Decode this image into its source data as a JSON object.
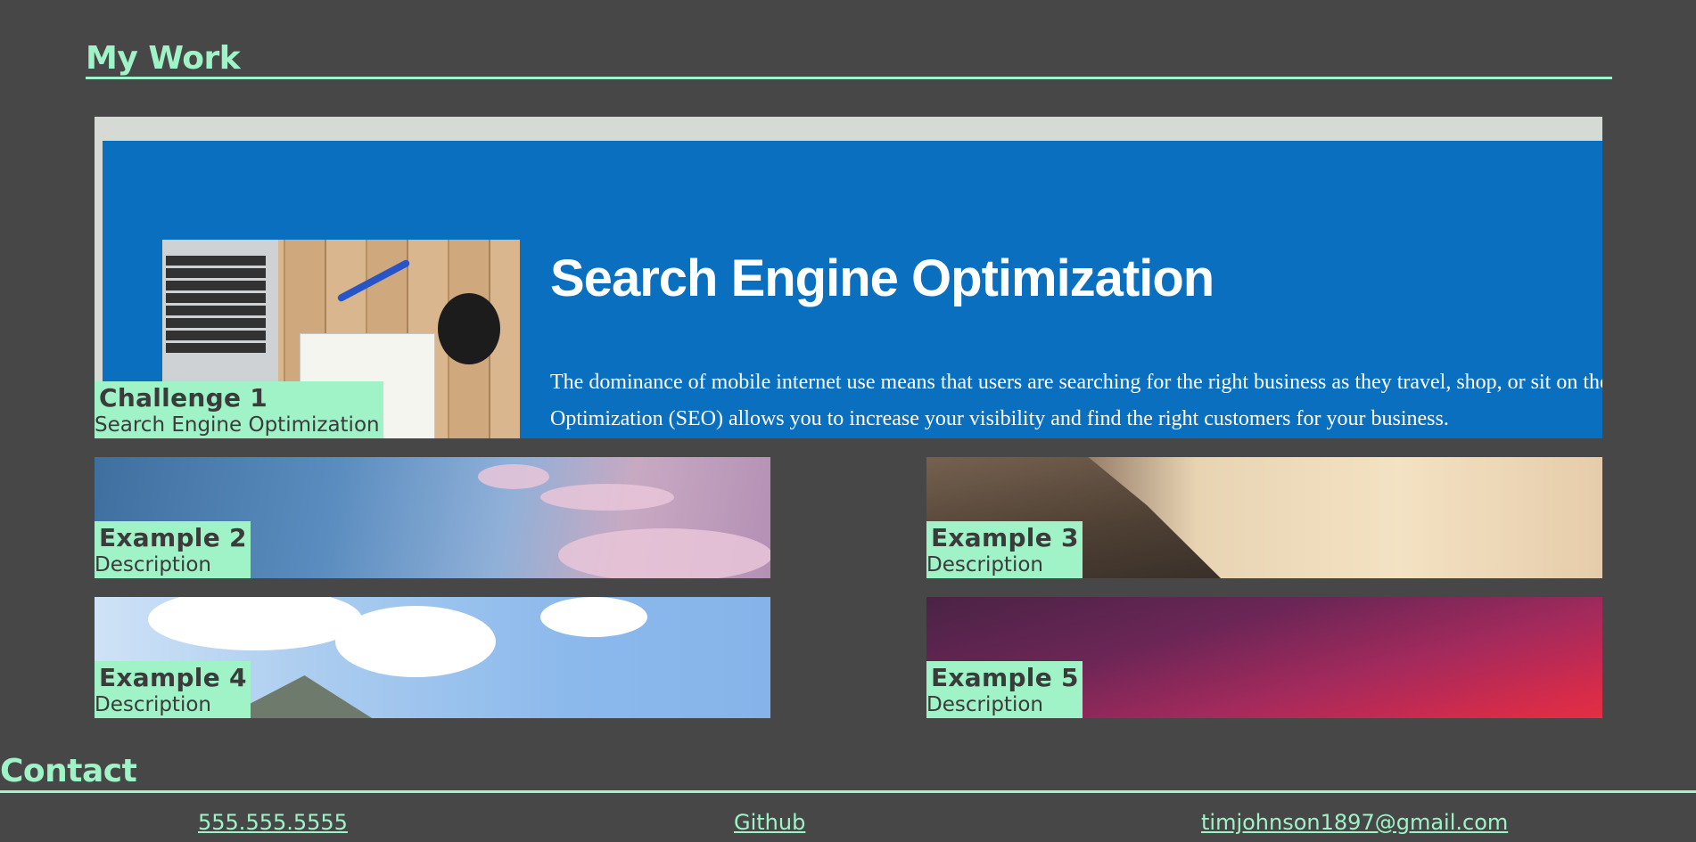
{
  "work": {
    "title": "My Work",
    "cards": [
      {
        "title": "Challenge 1",
        "description": "Search Engine Optimization",
        "image": {
          "headline": "Search Engine Optimization",
          "body_line_1": "The dominance of mobile internet use means that users are searching for the right business as they travel, shop, or sit on their couch at h",
          "body_line_2": "Optimization (SEO) allows you to increase your visibility and find the right customers for your business.",
          "colors": {
            "banner": "#0b6fbf",
            "frame": "#d6dad5"
          }
        }
      },
      {
        "title": "Example 2",
        "description": "Description"
      },
      {
        "title": "Example 3",
        "description": "Description"
      },
      {
        "title": "Example 4",
        "description": "Description"
      },
      {
        "title": "Example 5",
        "description": "Description"
      }
    ]
  },
  "contact": {
    "title": "Contact",
    "links": {
      "phone": "555.555.5555",
      "github": "Github",
      "email": "timjohnson1897@gmail.com"
    }
  },
  "colors": {
    "background": "#474747",
    "accent": "#9ff3c6",
    "label_text": "#3b3b3b"
  }
}
